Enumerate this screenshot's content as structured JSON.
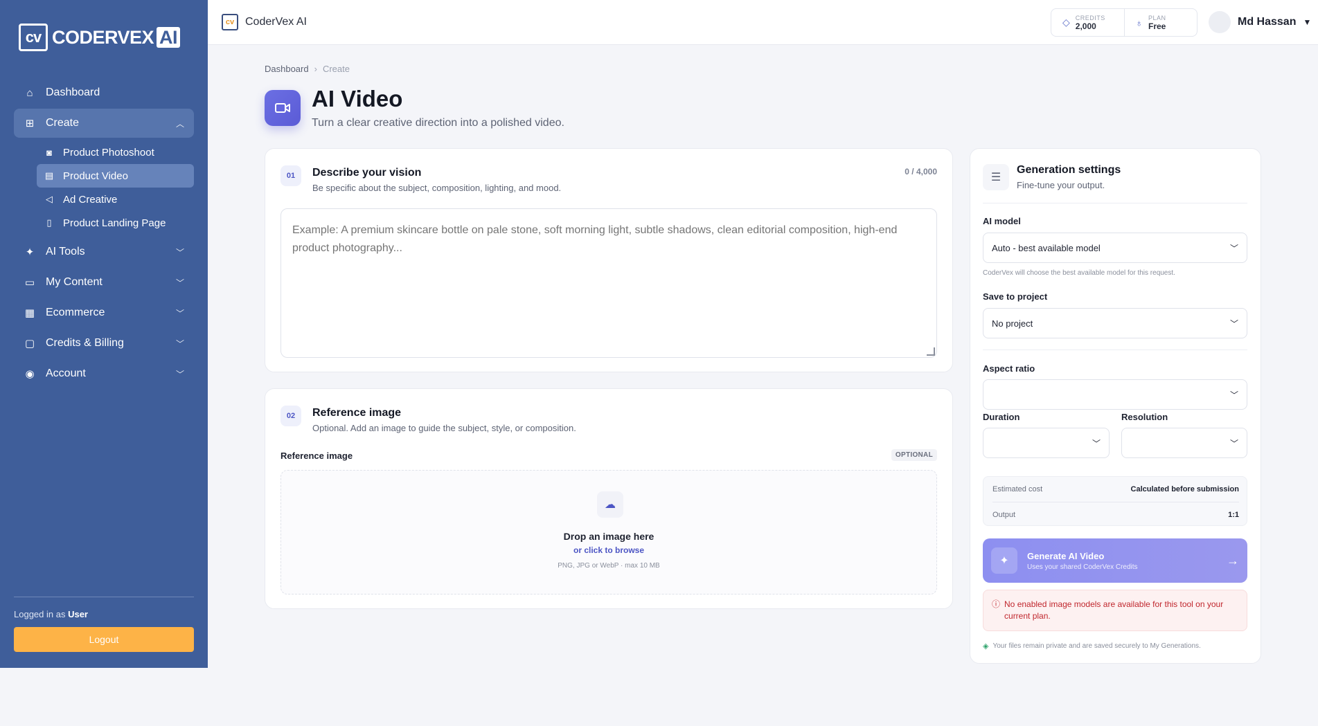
{
  "sidebar": {
    "logo_text": "CODERVEX",
    "logo_ai": "AI",
    "logo_mark": "cv",
    "items": [
      {
        "label": "Dashboard",
        "icon": "home-icon"
      },
      {
        "label": "Create",
        "icon": "plus-square-icon"
      },
      {
        "label": "AI Tools",
        "icon": "sparkles-icon"
      },
      {
        "label": "My Content",
        "icon": "folder-icon"
      },
      {
        "label": "Ecommerce",
        "icon": "store-icon"
      },
      {
        "label": "Credits & Billing",
        "icon": "wallet-icon"
      },
      {
        "label": "Account",
        "icon": "user-circle-icon"
      }
    ],
    "create_sub": [
      {
        "label": "Product Photoshoot",
        "icon": "camera-icon"
      },
      {
        "label": "Product Video",
        "icon": "film-icon"
      },
      {
        "label": "Ad Creative",
        "icon": "megaphone-icon"
      },
      {
        "label": "Product Landing Page",
        "icon": "file-icon"
      }
    ],
    "logged_prefix": "Logged in as",
    "logged_user": "User",
    "logout_label": "Logout"
  },
  "header": {
    "brand": "CoderVex AI",
    "credits_label": "CREDITS",
    "credits_value": "2,000",
    "plan_label": "PLAN",
    "plan_value": "Free",
    "user_name": "Md Hassan"
  },
  "page": {
    "breadcrumb": [
      "Dashboard",
      "Create"
    ],
    "title": "AI Video",
    "subtitle": "Turn a clear creative direction into a polished video."
  },
  "vision": {
    "step": "01",
    "title": "Describe your vision",
    "desc": "Be specific about the subject, composition, lighting, and mood.",
    "counter": "0 / 4,000",
    "placeholder": "Example: A premium skincare bottle on pale stone, soft morning light, subtle shadows, clean editorial composition, high-end product photography..."
  },
  "reference": {
    "step": "02",
    "title": "Reference image",
    "desc": "Optional. Add an image to guide the subject, style, or composition.",
    "field_label": "Reference image",
    "badge": "OPTIONAL",
    "drop_title": "Drop an image here",
    "drop_link": "or click to browse",
    "drop_hint": "PNG, JPG or WebP · max 10 MB"
  },
  "settings": {
    "title": "Generation settings",
    "subtitle": "Fine-tune your output.",
    "model_label": "AI model",
    "model_value": "Auto - best available model",
    "model_help": "CoderVex will choose the best available model for this request.",
    "project_label": "Save to project",
    "project_value": "No project",
    "aspect_label": "Aspect ratio",
    "aspect_value": "",
    "duration_label": "Duration",
    "duration_value": "",
    "resolution_label": "Resolution",
    "resolution_value": "",
    "cost_label": "Estimated cost",
    "cost_value": "Calculated before submission",
    "output_label": "Output",
    "output_value": "1:1",
    "generate_title": "Generate AI Video",
    "generate_sub": "Uses your shared CoderVex Credits",
    "error": "No enabled image models are available for this tool on your current plan.",
    "privacy": "Your files remain private and are saved securely to My Generations."
  },
  "colors": {
    "sidebar": "#3f5e9a",
    "accent": "#5b5bd6",
    "logout": "#fdb347",
    "error": "#c0262d"
  }
}
